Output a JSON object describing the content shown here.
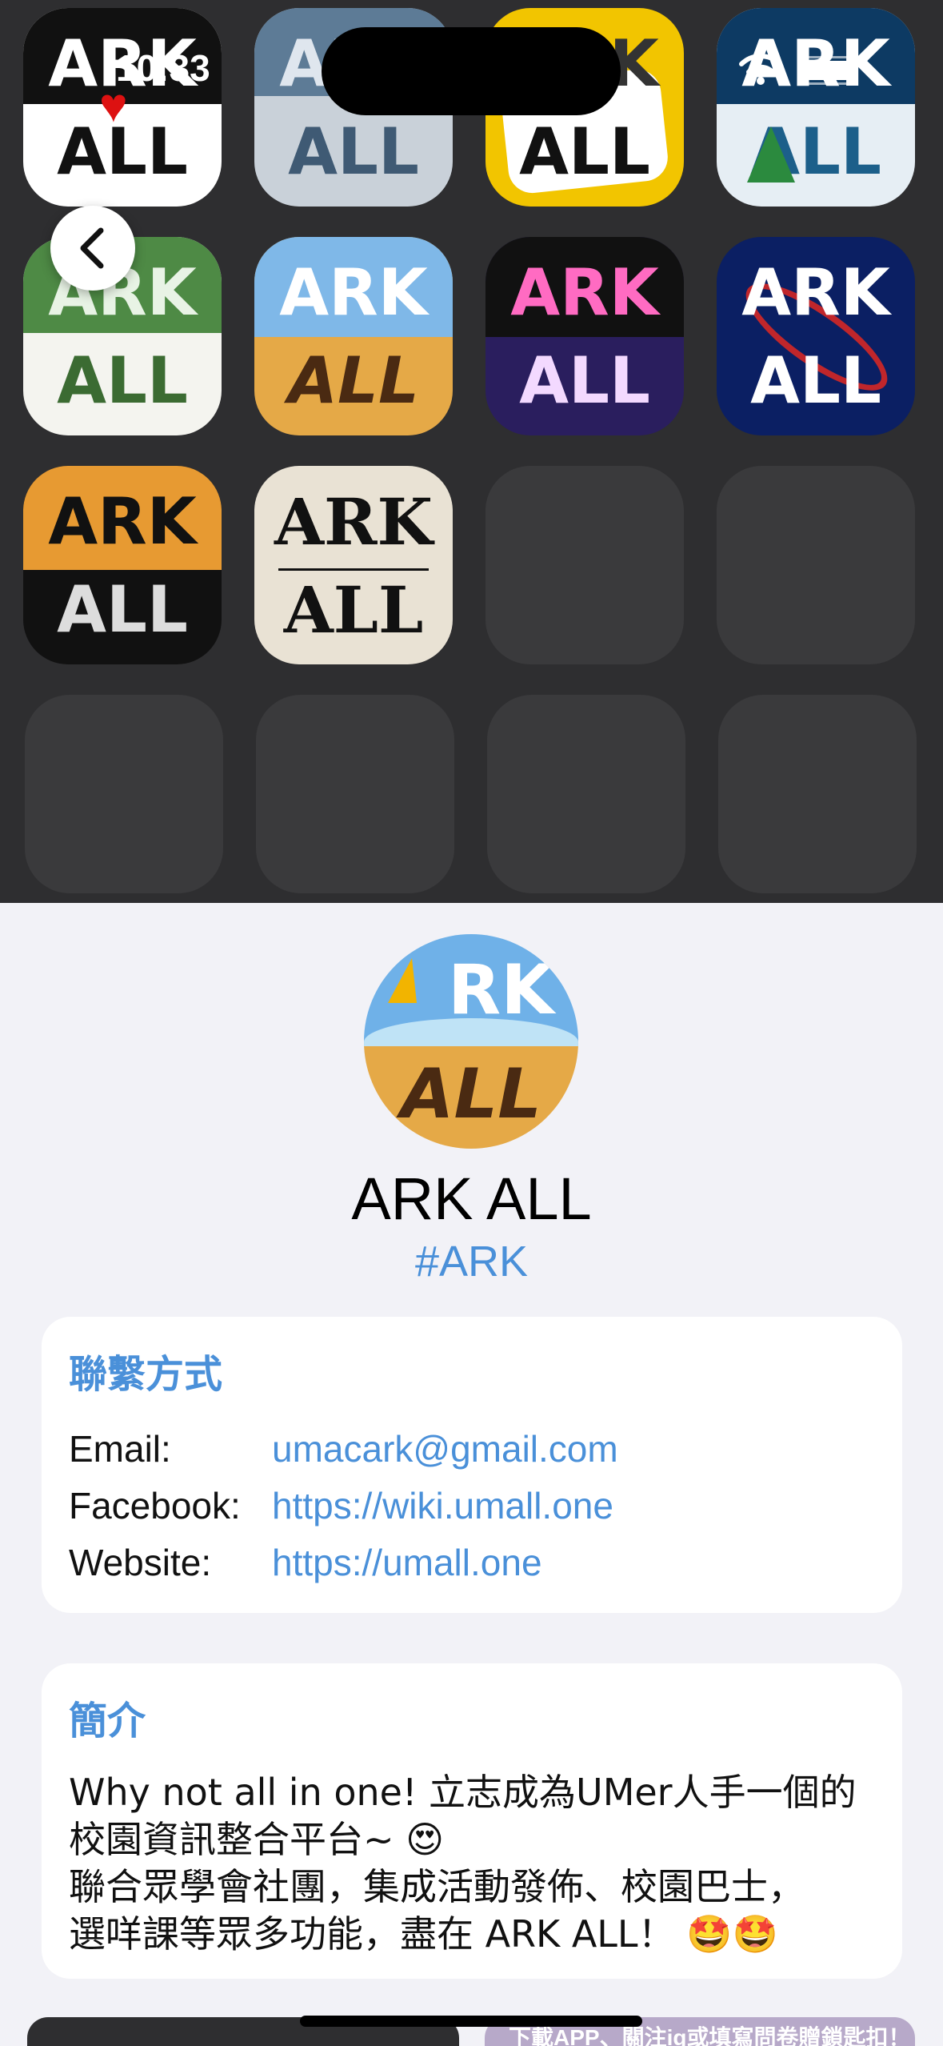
{
  "status_bar": {
    "time": "10:33"
  },
  "icon_grid": {
    "icons": [
      {
        "name": "ark-all-love",
        "ark": "ARK",
        "all": "ALL",
        "bg": "#ffffff",
        "fg": "#111111"
      },
      {
        "name": "ark-all-slate",
        "ark": "ARK",
        "all": "ALL",
        "bg": "#c9d1d9",
        "fg": "#3f5a74"
      },
      {
        "name": "ark-all-comic",
        "ark": "ARK",
        "all": "ALL",
        "bg": "#f2c500",
        "fg": "#111111"
      },
      {
        "name": "ark-all-christmas",
        "ark": "ARK",
        "all": "ALL",
        "bg": "#e6eef4",
        "fg": "#1c5f8a"
      },
      {
        "name": "ark-all-clover",
        "ark": "ARK",
        "all": "ALL",
        "bg": "#f4f4ef",
        "fg": "#3b6b32"
      },
      {
        "name": "ark-all-beach",
        "ark": "ARK",
        "all": "ALL",
        "bg": "#e5a947",
        "fg": "#4a2a12"
      },
      {
        "name": "ark-all-neon",
        "ark": "ARK",
        "all": "ALL",
        "bg": "#2a1e5e",
        "fg": "#f3d9ff"
      },
      {
        "name": "ark-all-space",
        "ark": "ARK",
        "all": "ALL",
        "bg": "#0b1f63",
        "fg": "#ffffff"
      },
      {
        "name": "ark-all-orange",
        "ark": "ARK",
        "all": "ALL",
        "bg": "#e79a32",
        "fg": "#111111"
      },
      {
        "name": "ark-all-newspaper",
        "ark": "ARK",
        "all": "ALL",
        "bg": "#e9e2d4",
        "fg": "#111111"
      }
    ]
  },
  "profile": {
    "name": "ARK ALL",
    "tag": "#ARK",
    "avatar_ark": "RK",
    "avatar_all": "ALL"
  },
  "contact": {
    "title": "聯繫方式",
    "rows": [
      {
        "label": "Email:",
        "value": "umacark@gmail.com"
      },
      {
        "label": "Facebook:",
        "value": "https://wiki.umall.one"
      },
      {
        "label": "Website:",
        "value": "https://umall.one"
      }
    ]
  },
  "intro": {
    "title": "簡介",
    "lines": [
      "Why not all in one! 立志成為UMer人手一個的",
      "校園資訊整合平台~ 😍",
      "聯合眾學會社團，集成活動發佈、校園巴士，",
      "選咩課等眾多功能，盡在 ARK ALL！ 🤩🤩"
    ]
  },
  "banner_text": "下載APP、關注ig或填寫問卷贈鎖匙扣！",
  "colors": {
    "accent": "#4a90d9",
    "top_bg": "#2e2e30",
    "page_bg": "#f2f2f7"
  }
}
